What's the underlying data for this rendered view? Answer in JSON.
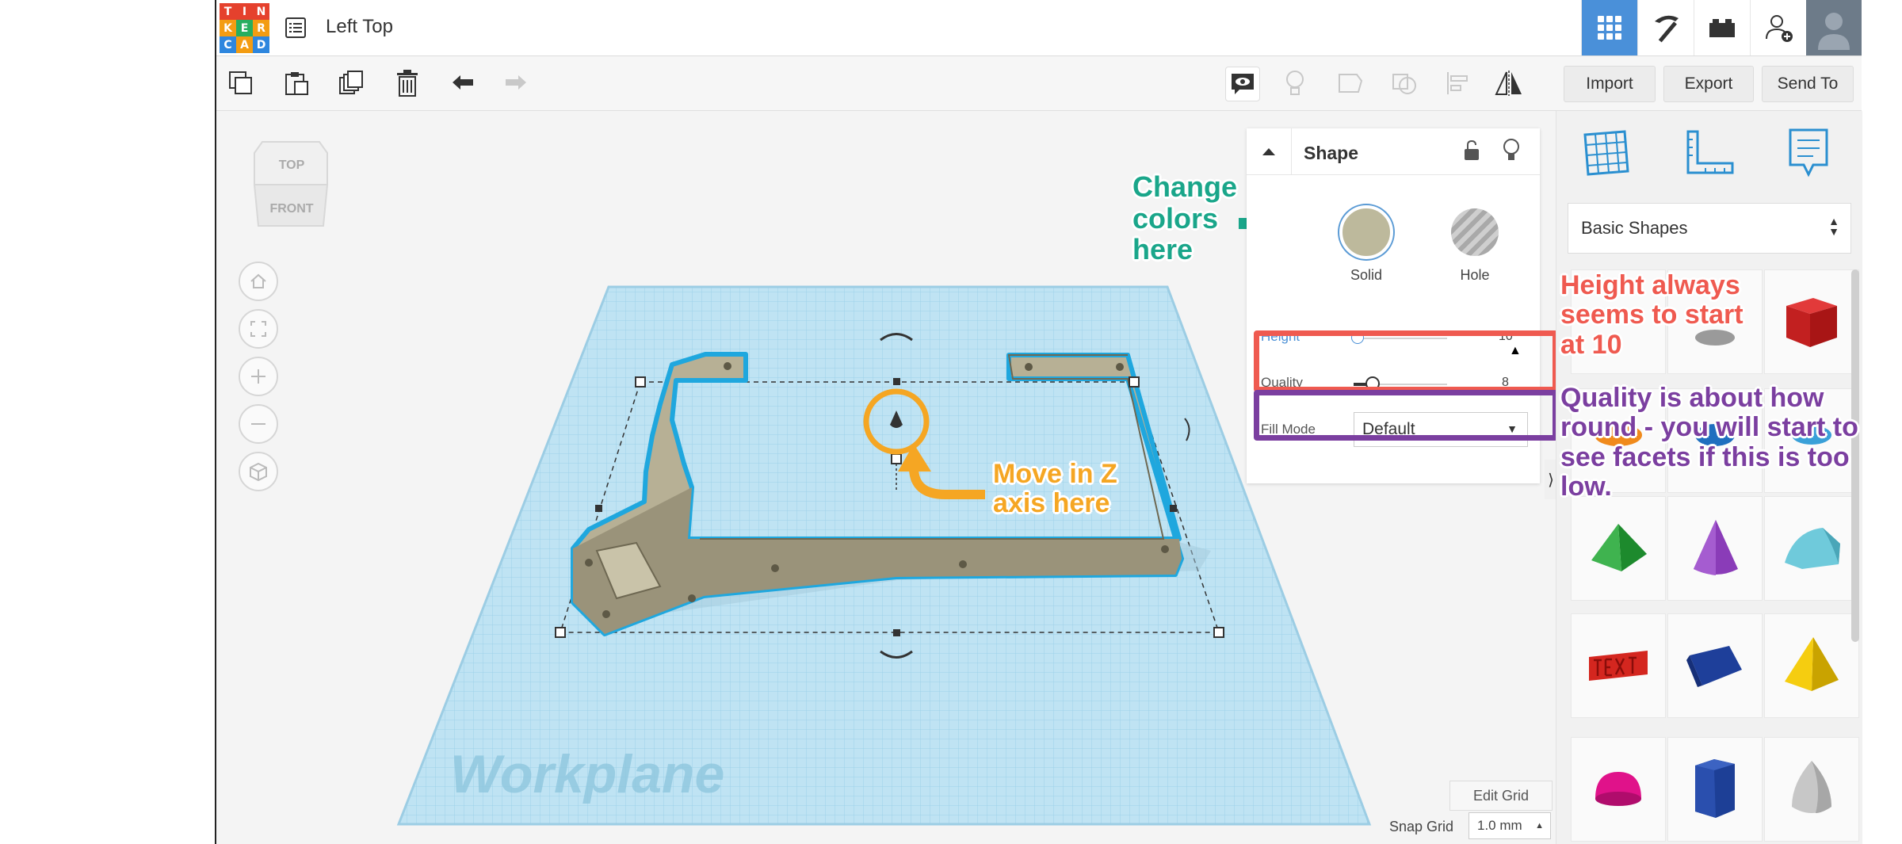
{
  "app": {
    "logo_letters": [
      "T",
      "I",
      "N",
      "K",
      "E",
      "R",
      "C",
      "A",
      "D"
    ],
    "logo_colors": [
      "#e5412d",
      "#e5412d",
      "#e5412d",
      "#f39c12",
      "#27ae60",
      "#f39c12",
      "#2e86de",
      "#f39c12",
      "#2e86de"
    ],
    "title": "Left Top"
  },
  "header_buttons": [
    {
      "name": "3d-design-view",
      "icon": "grid-icon",
      "active": true
    },
    {
      "name": "codeblocks-view",
      "icon": "pickaxe-icon",
      "active": false
    },
    {
      "name": "bricks-view",
      "icon": "brick-icon",
      "active": false
    },
    {
      "name": "add-user",
      "icon": "add-user-icon",
      "active": false
    }
  ],
  "toolbar": {
    "import_label": "Import",
    "export_label": "Export",
    "sendto_label": "Send To"
  },
  "viewcube": {
    "top_label": "TOP",
    "front_label": "FRONT"
  },
  "inspector": {
    "title": "Shape",
    "solid_label": "Solid",
    "hole_label": "Hole",
    "solid_color": "#bdb99c",
    "height_label": "Height",
    "height_value": "10",
    "quality_label": "Quality",
    "quality_value": "8",
    "fill_mode_label": "Fill Mode",
    "fill_mode_value": "Default"
  },
  "rpanel": {
    "category": "Basic Shapes",
    "shapes": [
      "box",
      "cylinder",
      "sphere",
      "pyramid-green",
      "cone",
      "roof",
      "text",
      "wedge",
      "pyramid-yellow",
      "half-sphere",
      "polygon",
      "paraboloid"
    ]
  },
  "workplane": {
    "label": "Workplane",
    "edit_grid_label": "Edit Grid",
    "snap_grid_label": "Snap Grid",
    "snap_grid_value": "1.0 mm"
  },
  "annotations": {
    "change_colors": [
      "Change",
      "colors",
      "here"
    ],
    "move_z": [
      "Move in Z",
      "axis here"
    ],
    "height_note": [
      "Height always",
      "seems to start",
      "at 10"
    ],
    "quality_note": [
      "Quality is about how",
      "round - you will start to",
      "see facets if this is too",
      "low."
    ]
  },
  "colors": {
    "accent_blue": "#4a90d9",
    "annotation_teal": "#1aa68a",
    "annotation_orange": "#f5a623",
    "annotation_red": "#ef5a50",
    "annotation_purple": "#7b3fa0",
    "selection_outline": "#29a8e0"
  }
}
